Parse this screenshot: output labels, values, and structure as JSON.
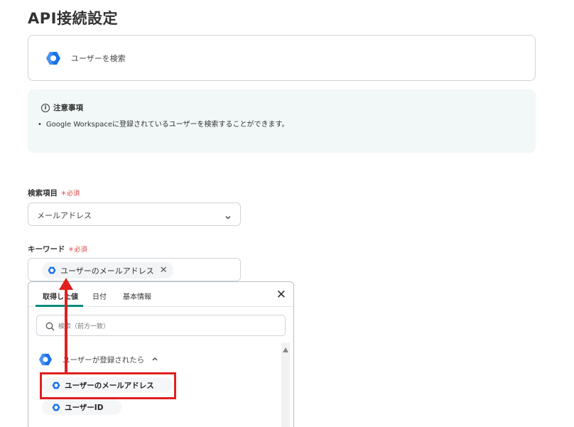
{
  "page": {
    "title": "API接続設定"
  },
  "action": {
    "label": "ユーザーを検索",
    "icon": "google-workspace-hex-icon"
  },
  "notice": {
    "heading": "注意事項",
    "info_glyph": "i",
    "bullet_glyph": "•",
    "body": "Google Workspaceに登録されているユーザーを検索することができます。"
  },
  "search_field": {
    "label": "検索項目",
    "required_mark": "＊",
    "required_text": "必須",
    "value": "メールアドレス"
  },
  "keyword_field": {
    "label": "キーワード",
    "required_mark": "＊",
    "required_text": "必須",
    "chip_label": "ユーザーのメールアドレス",
    "chip_remove": "✕"
  },
  "dropdown": {
    "tabs": [
      {
        "label": "取得した値",
        "active": true
      },
      {
        "label": "日付",
        "active": false
      },
      {
        "label": "基本情報",
        "active": false
      }
    ],
    "close_glyph": "✕",
    "search_placeholder": "検索（前方一致）",
    "group_label": "ユーザーが登録されたら",
    "items": [
      {
        "label": "ユーザーのメールアドレス"
      },
      {
        "label": "ユーザーID"
      }
    ]
  },
  "colors": {
    "accent_teal": "#0b8a7a",
    "required_red": "#e23d3d",
    "annotation_red": "#e02020",
    "google_blue": "#1a73e8",
    "notice_bg": "#f1f8f7"
  }
}
